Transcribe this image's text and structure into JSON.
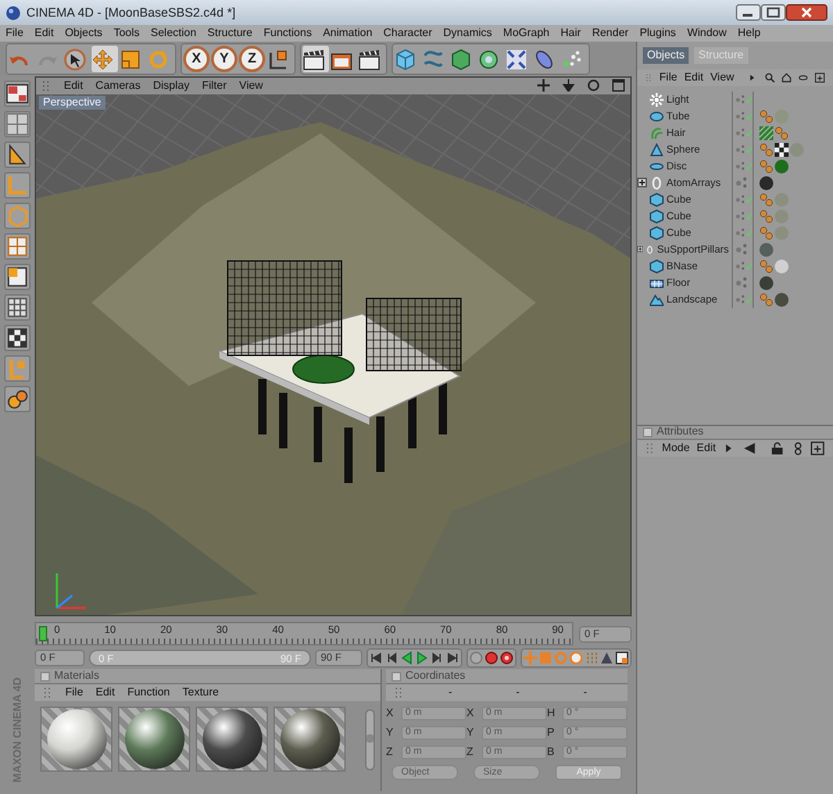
{
  "window": {
    "title": "CINEMA 4D - [MoonBaseSBS2.c4d *]"
  },
  "menu": [
    "File",
    "Edit",
    "Objects",
    "Tools",
    "Selection",
    "Structure",
    "Functions",
    "Animation",
    "Character",
    "Dynamics",
    "MoGraph",
    "Hair",
    "Render",
    "Plugins",
    "Window",
    "Help"
  ],
  "toolbar": {
    "tools": [
      {
        "kind": "undo",
        "selected": false,
        "disabled": false
      },
      {
        "kind": "redo",
        "selected": false,
        "disabled": true
      },
      {
        "kind": "select",
        "selected": false,
        "disabled": false
      },
      {
        "kind": "move",
        "selected": true,
        "disabled": false
      },
      {
        "kind": "scale",
        "selected": false,
        "disabled": false
      },
      {
        "kind": "rotate",
        "selected": false,
        "disabled": false
      }
    ],
    "axes": [
      {
        "label": "X",
        "on": true
      },
      {
        "label": "Y",
        "on": true
      },
      {
        "label": "Z",
        "on": true
      }
    ]
  },
  "viewport": {
    "menu": [
      "Edit",
      "Cameras",
      "Display",
      "Filter",
      "View"
    ],
    "camera": "Perspective"
  },
  "object_manager": {
    "tabs": [
      {
        "label": "Objects",
        "selected": true
      },
      {
        "label": "Structure",
        "selected": false
      }
    ],
    "menu": [
      "File",
      "Edit",
      "View"
    ],
    "objects": [
      {
        "name": "Light",
        "kind": "light",
        "collapsed": false,
        "enabled": true
      },
      {
        "name": "Tube",
        "kind": "tube",
        "collapsed": false,
        "enabled": true,
        "tags": [
          {
            "kind": "phong"
          },
          {
            "kind": "material",
            "color": "#8c9680"
          }
        ]
      },
      {
        "name": "Hair",
        "kind": "hair",
        "collapsed": false,
        "enabled": true,
        "tags": [
          {
            "kind": "hair"
          },
          {
            "kind": "phong"
          }
        ]
      },
      {
        "name": "Sphere",
        "kind": "cone",
        "collapsed": false,
        "enabled": true,
        "tags": [
          {
            "kind": "phong"
          },
          {
            "kind": "checker"
          },
          {
            "kind": "material",
            "color": "#8a9080"
          }
        ]
      },
      {
        "name": "Disc",
        "kind": "disc",
        "collapsed": false,
        "enabled": true,
        "tags": [
          {
            "kind": "phong"
          },
          {
            "kind": "material",
            "color": "#1e6e1e"
          }
        ]
      },
      {
        "name": "AtomArrays",
        "kind": "array",
        "collapsed": true,
        "enabled": false,
        "tags": [
          {
            "kind": "material",
            "color": "#2a2a2a"
          }
        ]
      },
      {
        "name": "Cube",
        "kind": "cube",
        "collapsed": false,
        "enabled": true,
        "tags": [
          {
            "kind": "phong"
          },
          {
            "kind": "material",
            "color": "#8a9080"
          }
        ]
      },
      {
        "name": "Cube",
        "kind": "cube",
        "collapsed": false,
        "enabled": true,
        "tags": [
          {
            "kind": "phong"
          },
          {
            "kind": "material",
            "color": "#8a9080"
          }
        ]
      },
      {
        "name": "Cube",
        "kind": "cube",
        "collapsed": false,
        "enabled": true,
        "tags": [
          {
            "kind": "phong"
          },
          {
            "kind": "material",
            "color": "#8a9080"
          }
        ]
      },
      {
        "name": "SuSpportPillars",
        "kind": "array",
        "collapsed": true,
        "enabled": false,
        "tags": [
          {
            "kind": "material",
            "color": "#55605a"
          }
        ]
      },
      {
        "name": "BNase",
        "kind": "cube",
        "collapsed": false,
        "enabled": true,
        "tags": [
          {
            "kind": "phong"
          },
          {
            "kind": "material",
            "color": "#d0d0d0"
          }
        ]
      },
      {
        "name": "Floor",
        "kind": "floor",
        "collapsed": false,
        "enabled": false,
        "tags": [
          {
            "kind": "material",
            "color": "#3a3f38"
          }
        ]
      },
      {
        "name": "Landscape",
        "kind": "landscape",
        "collapsed": false,
        "enabled": true,
        "tags": [
          {
            "kind": "phong"
          },
          {
            "kind": "material",
            "color": "#4a4c40"
          }
        ]
      }
    ]
  },
  "attributes": {
    "title": "Attributes",
    "checked": false,
    "menu": [
      "Mode",
      "Edit"
    ]
  },
  "timeline": {
    "labels": [
      "0",
      "10",
      "20",
      "30",
      "40",
      "50",
      "60",
      "70",
      "80",
      "90"
    ],
    "level": 0,
    "current": "0 F",
    "start": "0 F",
    "range": {
      "start": "0 F",
      "end": "90 F",
      "level": 1
    },
    "end": "90 F"
  },
  "materials": {
    "title": "Materials",
    "checked": false,
    "menu": [
      "File",
      "Edit",
      "Function",
      "Texture"
    ],
    "swatches": [
      {
        "color": "#d4d4d0"
      },
      {
        "color": "#5e7a5a"
      },
      {
        "color": "#4c4c4c"
      },
      {
        "color": "#5e5e50"
      }
    ]
  },
  "coordinates": {
    "title": "Coordinates",
    "checked": false,
    "columns": [
      {
        "header": "-",
        "fields": [
          {
            "axis": "X",
            "value": "0 m"
          },
          {
            "axis": "Y",
            "value": "0 m"
          },
          {
            "axis": "Z",
            "value": "0 m"
          }
        ]
      },
      {
        "header": "-",
        "fields": [
          {
            "axis": "X",
            "value": "0 m"
          },
          {
            "axis": "Y",
            "value": "0 m"
          },
          {
            "axis": "Z",
            "value": "0 m"
          }
        ]
      },
      {
        "header": "-",
        "fields": [
          {
            "axis": "H",
            "value": "0 °"
          },
          {
            "axis": "P",
            "value": "0 °"
          },
          {
            "axis": "B",
            "value": "0 °"
          }
        ]
      }
    ],
    "dropdowns": [
      "Object",
      "Size"
    ],
    "apply": "Apply"
  },
  "logo": {
    "brand": "MAXON",
    "product": "CINEMA 4D"
  }
}
